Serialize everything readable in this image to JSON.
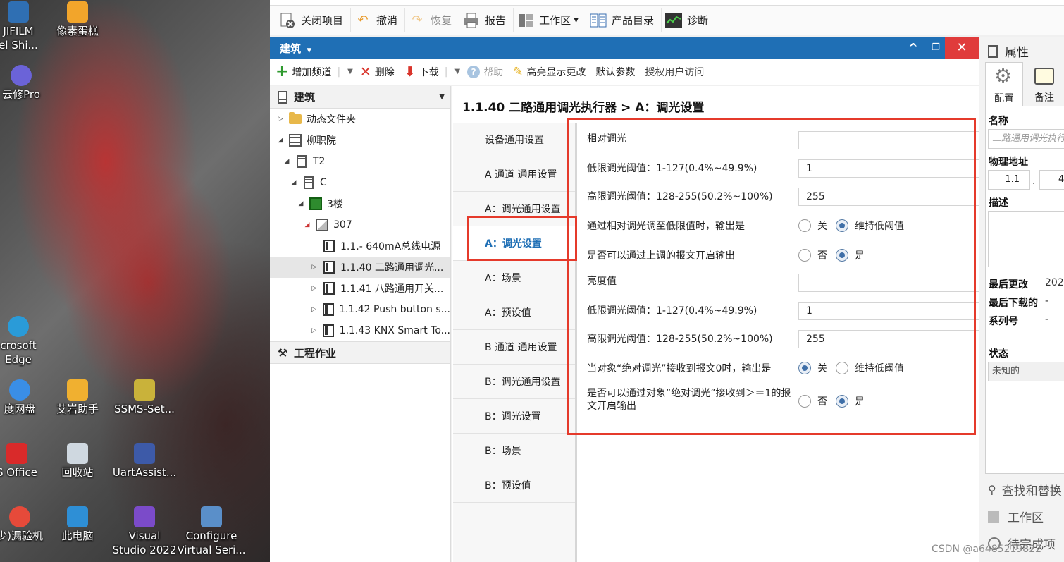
{
  "desktop": {
    "icons": [
      {
        "label1": "JIFILM",
        "label2": "el Shi...",
        "color": "#2f6fb3"
      },
      {
        "label1": "像素蛋糕",
        "label2": "",
        "color": "#f2a52b"
      },
      {
        "label1": "云修Pro",
        "label2": "",
        "color": "#6b63d8"
      },
      {
        "label1": "crosoft",
        "label2": "Edge",
        "color": "#2a9bd8"
      },
      {
        "label1": "度网盘",
        "label2": "",
        "color": "#3a8ee6"
      },
      {
        "label1": "艾岩助手",
        "label2": "",
        "color": "#f0b030"
      },
      {
        "label1": "SSMS-Set...",
        "label2": "",
        "color": "#c9b23a"
      },
      {
        "label1": "S Office",
        "label2": "",
        "color": "#d92a2a"
      },
      {
        "label1": "回收站",
        "label2": "",
        "color": "#cfd8e0"
      },
      {
        "label1": "UartAssist...",
        "label2": "",
        "color": "#3d5aa8"
      },
      {
        "label1": "少)漏验机",
        "label2": "",
        "color": "#e64a3a"
      },
      {
        "label1": "此电脑",
        "label2": "",
        "color": "#2e8fd6"
      },
      {
        "label1": "Visual",
        "label2": "Studio 2022",
        "color": "#7b4bc9"
      },
      {
        "label1": "Configure",
        "label2": "Virtual Seri...",
        "color": "#5a8fc9"
      }
    ]
  },
  "toolbar": {
    "close_project": "关闭项目",
    "undo": "撤消",
    "redo": "恢复",
    "report": "报告",
    "workspace": "工作区",
    "catalog": "产品目录",
    "diagnostics": "诊断"
  },
  "panel": {
    "title": "建筑",
    "minimize_glyph": "^",
    "restore_glyph": "❐",
    "close_glyph": "✕"
  },
  "subtoolbar": {
    "add_channel": "增加频道",
    "delete": "删除",
    "download": "下载",
    "help": "帮助",
    "highlight": "高亮显示更改",
    "default_params": "默认参数",
    "authorize": "授权用户访问"
  },
  "tree": {
    "header": "建筑",
    "items": [
      {
        "label": "动态文件夹",
        "twisty": "▷",
        "type": "folder"
      },
      {
        "label": "柳职院",
        "twisty": "◢",
        "type": "building"
      },
      {
        "label": "T2",
        "twisty": "◢",
        "type": "building"
      },
      {
        "label": "C",
        "twisty": "◢",
        "type": "building"
      },
      {
        "label": "3楼",
        "twisty": "◢",
        "type": "floor"
      },
      {
        "label": "307",
        "twisty": "◢",
        "type": "room"
      },
      {
        "label": "1.1.- 640mA总线电源",
        "twisty": "",
        "type": "device"
      },
      {
        "label": "1.1.40 二路通用调光...",
        "twisty": "▷",
        "type": "device"
      },
      {
        "label": "1.1.41 八路通用开关...",
        "twisty": "▷",
        "type": "device"
      },
      {
        "label": "1.1.42 Push button s...",
        "twisty": "▷",
        "type": "device"
      },
      {
        "label": "1.1.43 KNX Smart To...",
        "twisty": "▷",
        "type": "device"
      }
    ],
    "tools_header": "工程作业"
  },
  "content": {
    "breadcrumb": "1.1.40 二路通用调光执行器 > A：调光设置",
    "tabs": [
      "设备通用设置",
      "A 通道 通用设置",
      "A：调光通用设置",
      "A：调光设置",
      "A：场景",
      "A：预设值",
      "B 通道 通用设置",
      "B：调光通用设置",
      "B：调光设置",
      "B：场景",
      "B：预设值"
    ],
    "active_tab": "A：调光设置",
    "params": {
      "relative_dimming": "相对调光",
      "low_threshold_label_1": "低限调光阈值：1-127(0.4%~49.9%)",
      "low_threshold_value_1": "1",
      "high_threshold_label_1": "高限调光阈值：128-255(50.2%~100%)",
      "high_threshold_value_1": "255",
      "relative_low_output_label": "通过相对调光调至低限值时，输出是",
      "relative_low_output_opt_off": "关",
      "relative_low_output_opt_keep": "维持低阈值",
      "relative_low_output_selected": "维持低阈值",
      "up_telegram_label": "是否可以通过上调的报文开启输出",
      "up_telegram_opt_no": "否",
      "up_telegram_opt_yes": "是",
      "up_telegram_selected": "是",
      "brightness": "亮度值",
      "low_threshold_label_2": "低限调光阈值：1-127(0.4%~49.9%)",
      "low_threshold_value_2": "1",
      "high_threshold_label_2": "高限调光阈值：128-255(50.2%~100%)",
      "high_threshold_value_2": "255",
      "absolute_zero_label": "当对象“绝对调光”接收到报文0时，输出是",
      "absolute_zero_opt_off": "关",
      "absolute_zero_opt_keep": "维持低阈值",
      "absolute_zero_selected": "关",
      "absolute_ge1_label_line1": "是否可以通过对象“绝对调光”接收到＞＝1的报",
      "absolute_ge1_label_line2": "文开启输出",
      "absolute_ge1_opt_no": "否",
      "absolute_ge1_opt_yes": "是",
      "absolute_ge1_selected": "是"
    }
  },
  "properties": {
    "title": "属性",
    "tab_config": "配置",
    "tab_notes": "备注",
    "name_label": "名称",
    "name_value": "二路通用调光执行",
    "address_label": "物理地址",
    "address_part1": "1.1",
    "address_dot": ".",
    "address_part2": "4",
    "description_label": "描述",
    "last_modified_label": "最后更改",
    "last_modified_value": "202",
    "last_download_label": "最后下载的",
    "last_download_value": "-",
    "serial_label": "系列号",
    "serial_value": "-",
    "status_label": "状态",
    "status_value": "未知的",
    "bottom_find": "查找和替换",
    "bottom_workspace": "工作区",
    "bottom_pending": "待完成项"
  },
  "watermark": "CSDN @a6485219822",
  "colors": {
    "accent_blue": "#1f6fb5",
    "annotation_red": "#e53a2b",
    "close_red": "#e03b3b"
  }
}
